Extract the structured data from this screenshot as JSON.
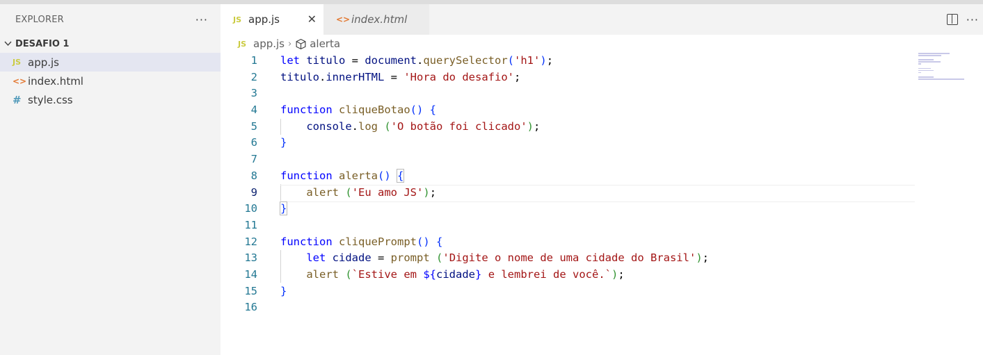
{
  "explorer": {
    "title": "EXPLORER",
    "more_label": "···",
    "folder": "DESAFIO 1",
    "files": [
      {
        "name": "app.js",
        "icon": "JS"
      },
      {
        "name": "index.html",
        "icon": "<>"
      },
      {
        "name": "style.css",
        "icon": "#"
      }
    ]
  },
  "tabs": [
    {
      "label": "app.js",
      "icon": "JS",
      "close": "✕"
    },
    {
      "label": "index.html",
      "icon": "<>"
    }
  ],
  "tabbar_more": "···",
  "breadcrumb": {
    "icon": "JS",
    "file": "app.js",
    "separator": "›",
    "symbol": "alerta"
  },
  "editor": {
    "current_line": 9,
    "line_numbers": [
      "1",
      "2",
      "3",
      "4",
      "5",
      "6",
      "7",
      "8",
      "9",
      "10",
      "11",
      "12",
      "13",
      "14",
      "15",
      "16"
    ]
  },
  "colors": {
    "keyword": "#0000ff",
    "variable": "#001080",
    "function": "#795e26",
    "string": "#a31515",
    "line_number": "#237893"
  }
}
